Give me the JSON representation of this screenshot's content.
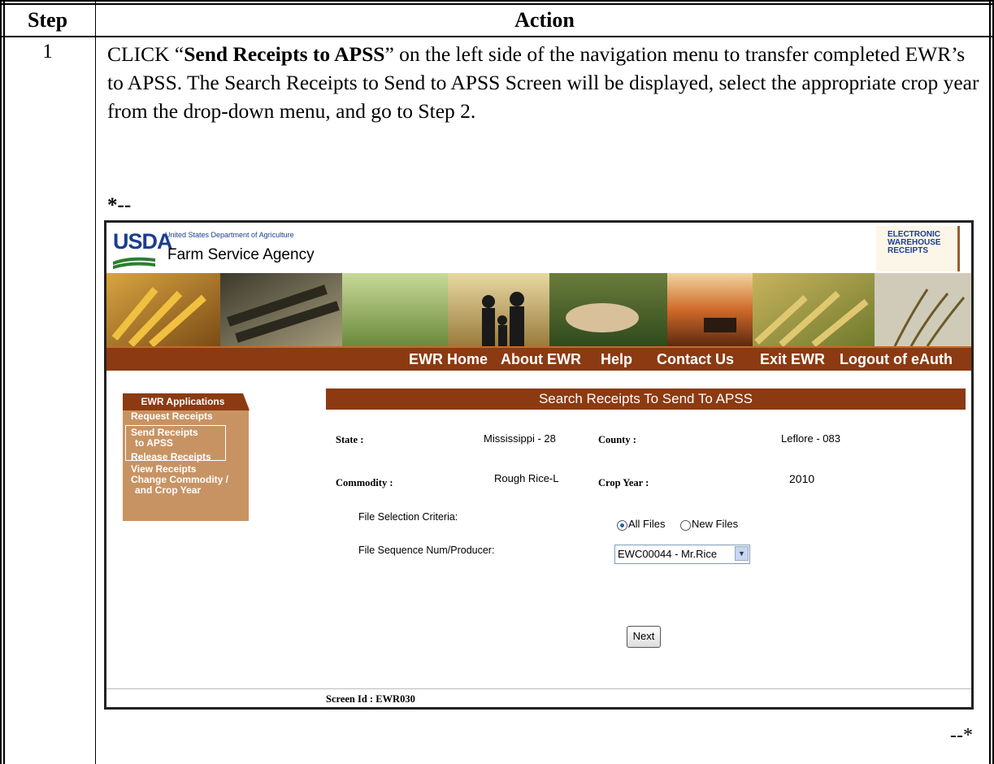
{
  "table": {
    "header_step": "Step",
    "header_action": "Action",
    "step_number": "1",
    "instruction_prefix": "CLICK “",
    "instruction_bold": "Send Receipts to APSS",
    "instruction_suffix": "” on the left side of the navigation menu to transfer completed EWR’s to APSS.  The Search Receipts to Send to APSS Screen will be displayed, select the appropriate crop year from the drop-down menu, and go to Step 2.",
    "change_mark_start": "*--",
    "change_mark_end": "--*"
  },
  "app": {
    "usda_logo": "USDA",
    "department": "United States Department of Agriculture",
    "agency": "Farm Service Agency",
    "ewr_logo_lines": [
      "ELECTRONIC",
      "WAREHOUSE",
      "RECEIPTS"
    ]
  },
  "nav": {
    "items": [
      "EWR Home",
      "About EWR",
      "Help",
      "Contact Us",
      "Exit EWR",
      "Logout of eAuth"
    ]
  },
  "sidebar": {
    "title": "EWR Applications",
    "items": [
      "Request Receipts",
      "Send Receipts",
      "to APSS",
      "Release Receipts",
      "View Receipts",
      "Change Commodity /",
      "and Crop Year"
    ]
  },
  "form": {
    "title": "Search Receipts To Send To APSS",
    "state_label": "State :",
    "state_value": "Mississippi - 28",
    "county_label": "County :",
    "county_value": "Leflore - 083",
    "commodity_label": "Commodity :",
    "commodity_value": "Rough Rice-L",
    "crop_year_label": "Crop Year :",
    "crop_year_value": "2010",
    "criteria_label": "File Selection Criteria:",
    "radio_all": "All Files",
    "radio_new": "New Files",
    "selected_radio": "All Files",
    "sequence_label": "File Sequence Num/Producer:",
    "sequence_value": "EWC00044 - Mr.Rice",
    "next_button": "Next",
    "screen_id": "Screen Id : EWR030"
  },
  "colors": {
    "nav_bar": "#8c3a12",
    "sidebar": "#c89363",
    "usda_blue": "#1c3d8f"
  }
}
